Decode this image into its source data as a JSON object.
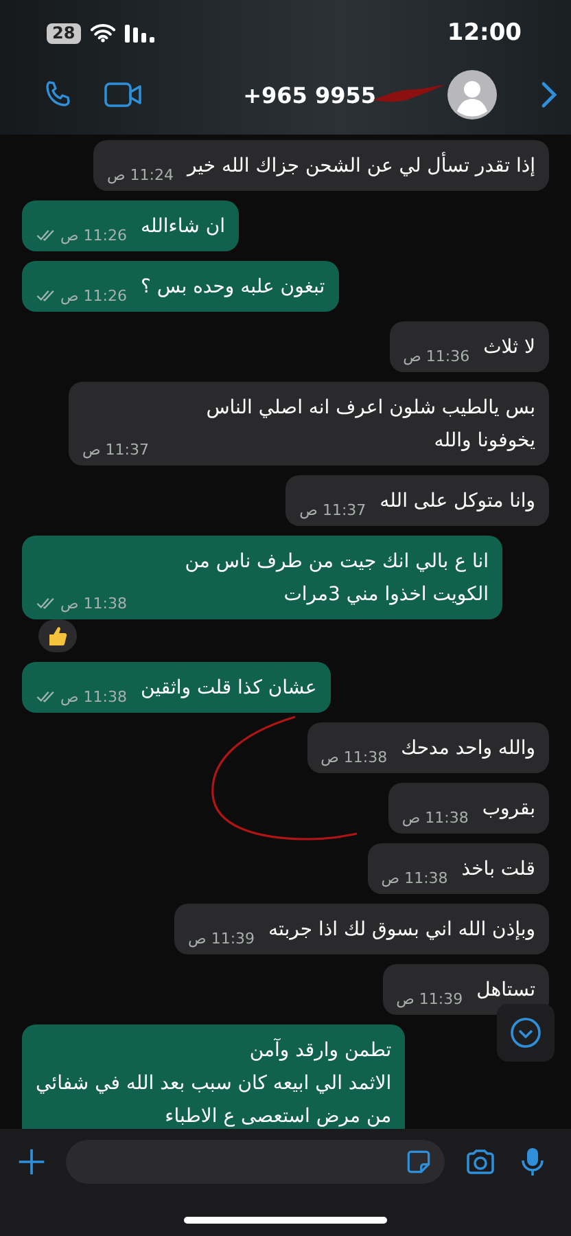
{
  "status_bar": {
    "time": "12:00",
    "battery": "28"
  },
  "header": {
    "title": "+965 9955"
  },
  "messages": [
    {
      "kind": "in",
      "text": "إذا تقدر تسأل لي عن الشحن جزاك الله خير",
      "time": "11:24 ص"
    },
    {
      "kind": "out",
      "text": "ان شاءالله",
      "time": "11:26 ص"
    },
    {
      "kind": "out",
      "text": "تبغون علبه وحده بس ؟",
      "time": "11:26 ص"
    },
    {
      "kind": "in",
      "text": "لا ثلاث",
      "time": "11:36 ص"
    },
    {
      "kind": "in",
      "text": "بس يالطيب شلون اعرف انه اصلي الناس يخوفونا والله",
      "time": "11:37 ص"
    },
    {
      "kind": "in",
      "text": "وانا متوكل على الله",
      "time": "11:37 ص"
    },
    {
      "kind": "out",
      "text": "انا ع بالي انك جيت من طرف ناس من الكويت اخذوا مني 3مرات",
      "time": "11:38 ص",
      "reaction": true
    },
    {
      "kind": "out",
      "text": "عشان كذا قلت واثقين",
      "time": "11:38 ص"
    },
    {
      "kind": "in",
      "text": "والله واحد مدحك",
      "time": "11:38 ص"
    },
    {
      "kind": "in",
      "text": "بقروب",
      "time": "11:38 ص"
    },
    {
      "kind": "in",
      "text": "قلت باخذ",
      "time": "11:38 ص"
    },
    {
      "kind": "in",
      "text": "وبإذن الله اني بسوق لك اذا جربته",
      "time": "11:39 ص"
    },
    {
      "kind": "in",
      "text": "تستاهل",
      "time": "11:39 ص"
    },
    {
      "kind": "out",
      "text": "تطمن وارقد وآمن\nالاثمد الي ابيعه كان سبب بعد الله في شفائي\nمن مرض استعصى ع الاطباء"
    }
  ]
}
